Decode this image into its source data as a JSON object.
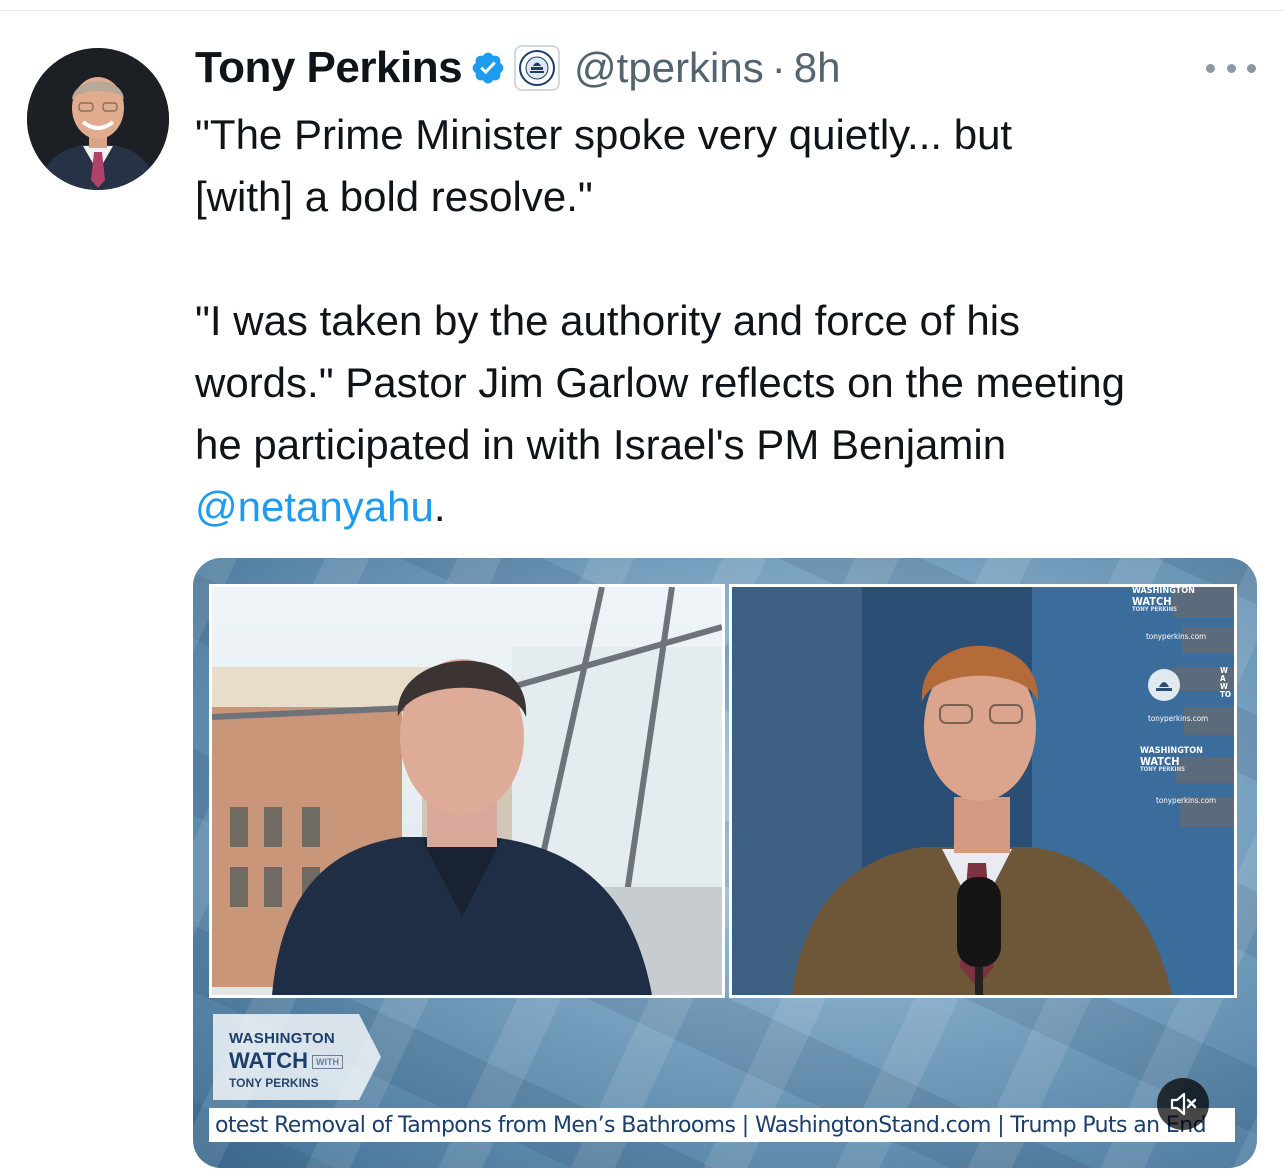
{
  "tweet": {
    "author": {
      "display_name": "Tony Perkins",
      "handle": "@tperkins",
      "separator": "·",
      "time": "8h"
    },
    "text": {
      "line1": "\"The Prime Minister spoke very quietly... but",
      "line2": "[with] a bold resolve.\"",
      "line3": "\"I was taken by the authority and force of his",
      "line4": "words.\" Pastor Jim Garlow reflects on the meeting",
      "line5": "he participated in with Israel's PM Benjamin",
      "mention": "@netanyahu",
      "end": "."
    },
    "icons": {
      "verified": "verified-check-icon",
      "affiliate": "capitol-seal-badge-icon",
      "more": "more-options-icon",
      "mute": "volume-muted-icon"
    }
  },
  "media": {
    "studio_wall": {
      "top_logo_l1": "WASHINGTON",
      "top_logo_l2": "WATCH",
      "top_logo_l3": "TONY PERKINS",
      "url1": "tonyperkins.com",
      "url2": "tonyperkins.com",
      "logo2_l1": "WASHINGTON",
      "logo2_l2": "WATCH",
      "logo2_l3": "TONY PERKINS",
      "url3": "tonyperkins.com",
      "edge_text": "WA W TO"
    },
    "show_logo": {
      "line1": "WASHINGTON",
      "line2": "WATCH",
      "with": "WITH",
      "line3": "TONY PERKINS"
    },
    "ticker": "otest Removal of Tampons from Men’s Bathrooms   | WashingtonStand.com |  Trump Puts an End"
  },
  "colors": {
    "link": "#1d9bf0",
    "verified": "#1d9bf0",
    "secondary_text": "#536471",
    "show_navy": "#1b3e6b"
  }
}
